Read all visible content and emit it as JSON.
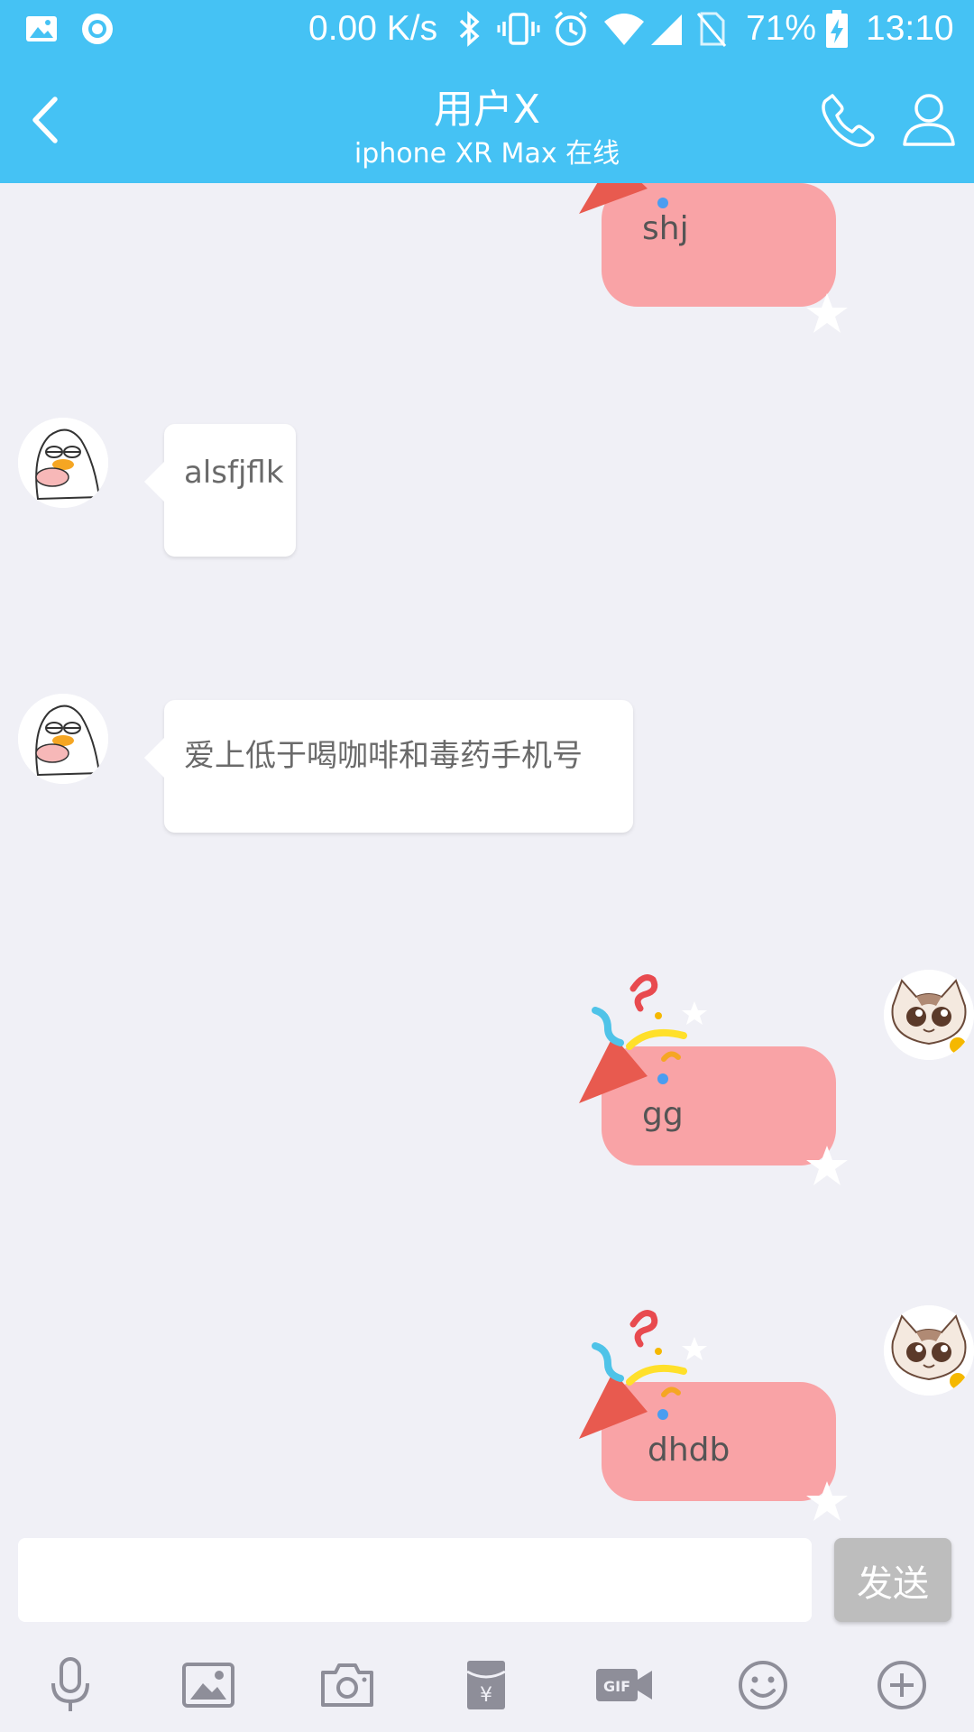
{
  "status_bar": {
    "net_speed": "0.00 K/s",
    "battery": "71%",
    "time": "13:10"
  },
  "header": {
    "title": "用户X",
    "subtitle": "iphone XR Max 在线",
    "back_icon": "back-arrow-icon",
    "call_icon": "phone-icon",
    "profile_icon": "person-icon"
  },
  "messages": [
    {
      "side": "out",
      "text": "shj"
    },
    {
      "side": "in",
      "text": "alsfjflk"
    },
    {
      "side": "in",
      "text": "爱上低于喝咖啡和毒药手机号"
    },
    {
      "side": "out",
      "text": "gg"
    },
    {
      "side": "out",
      "text": "dhdb"
    }
  ],
  "composer": {
    "input_value": "",
    "input_placeholder": "",
    "send_label": "发送"
  },
  "toolbar": [
    "microphone-icon",
    "image-icon",
    "camera-icon",
    "red-packet-icon",
    "gif-icon",
    "emoji-icon",
    "plus-icon"
  ],
  "colors": {
    "accent": "#45C2F4",
    "background": "#F0F0F6",
    "outgoing_bubble": "#F9A3A6",
    "incoming_bubble": "#FFFFFF",
    "send_button": "#BDBDBD"
  }
}
